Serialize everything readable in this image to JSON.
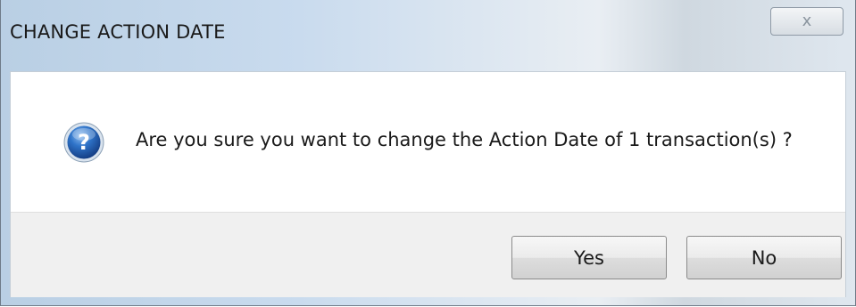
{
  "window": {
    "title": "CHANGE ACTION DATE",
    "close_glyph": "x"
  },
  "dialog": {
    "icon": "question-icon",
    "message": "Are you sure you want to change the Action Date of 1 transaction(s) ?"
  },
  "buttons": {
    "yes_label": "Yes",
    "no_label": "No"
  },
  "colors": {
    "title_bar": "#c9dbee",
    "icon_blue": "#1f5fb0",
    "button_strip": "#f0f0f0"
  }
}
